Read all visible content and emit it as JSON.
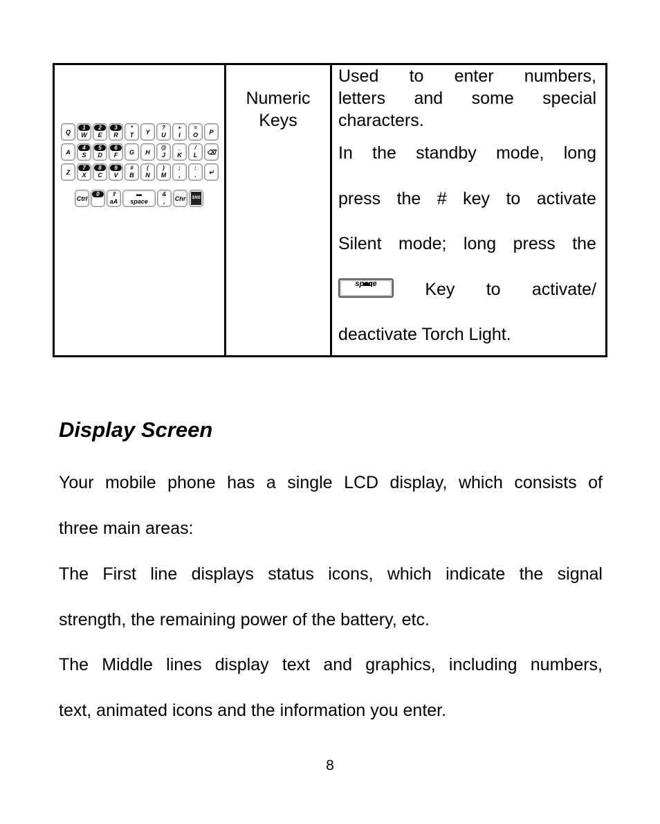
{
  "table": {
    "row": {
      "name_lines": [
        "Numeric",
        "Keys"
      ],
      "desc_para1_lines": [
        [
          "Used",
          "to",
          "enter",
          "numbers,"
        ],
        [
          "letters",
          "and",
          "some",
          "special"
        ],
        [
          "characters."
        ]
      ],
      "desc_para2_lines": [
        [
          "In",
          "the",
          "standby",
          "mode,",
          "long"
        ],
        [
          "press",
          "the",
          "#",
          "key",
          "to",
          "activate"
        ],
        [
          "Silent",
          "mode;",
          "long",
          "press",
          "the"
        ],
        [
          "Key",
          "to",
          "activate/"
        ],
        [
          "deactivate Torch Light."
        ]
      ],
      "inline_key_label": "space"
    },
    "keyboard": {
      "rows": [
        [
          {
            "b": "Q"
          },
          {
            "t": "1",
            "b": "W",
            "n": true
          },
          {
            "t": "2",
            "b": "E",
            "n": true
          },
          {
            "t": "3",
            "b": "R",
            "n": true
          },
          {
            "t": "*",
            "b": "T"
          },
          {
            "b": "Y"
          },
          {
            "t": "?",
            "b": "U"
          },
          {
            "t": "+",
            "b": "I"
          },
          {
            "t": "=",
            "b": "O"
          },
          {
            "b": "P"
          }
        ],
        [
          {
            "b": "A"
          },
          {
            "t": "4",
            "b": "S",
            "n": true
          },
          {
            "t": "5",
            "b": "D",
            "n": true
          },
          {
            "t": "6",
            "b": "F",
            "n": true
          },
          {
            "b": "G"
          },
          {
            "b": "H"
          },
          {
            "t": "@",
            "b": "J"
          },
          {
            "t": "_",
            "b": "K"
          },
          {
            "t": "/",
            "b": "L"
          },
          {
            "b": "⌫"
          }
        ],
        [
          {
            "b": "Z"
          },
          {
            "t": "7",
            "b": "X",
            "n": true
          },
          {
            "t": "8",
            "b": "C",
            "n": true
          },
          {
            "t": "9",
            "b": "V",
            "n": true
          },
          {
            "t": "#",
            "b": "B"
          },
          {
            "t": "(",
            "b": "N"
          },
          {
            "t": ")",
            "b": "M"
          },
          {
            "t": ";",
            "b": ","
          },
          {
            "t": ":",
            "b": "."
          },
          {
            "b": "↵"
          }
        ],
        [
          {
            "b": "Ctrl"
          },
          {
            "t": "0",
            "b": "",
            "n": true
          },
          {
            "t": "⇧",
            "b": "aA"
          },
          {
            "t": "▬",
            "b": "space",
            "space": true
          },
          {
            "t": "&",
            "b": ","
          },
          {
            "b": "Chr"
          },
          {
            "b": "SNS",
            "sns": true
          }
        ]
      ]
    }
  },
  "section": {
    "heading": "Display Screen",
    "paragraphs": [
      [
        [
          "Your",
          "mobile",
          "phone",
          "has",
          "a",
          "single",
          "LCD",
          "display,",
          "which",
          "consists",
          "of"
        ],
        [
          "three main areas:"
        ]
      ],
      [
        [
          "The",
          "First",
          "line",
          "displays",
          "status",
          "icons,",
          "which",
          "indicate",
          "the",
          "signal"
        ],
        [
          "strength, the remaining power of the battery, etc."
        ]
      ],
      [
        [
          "The",
          "Middle",
          "lines",
          "display",
          "text",
          "and",
          "graphics,",
          "including",
          "numbers,"
        ],
        [
          "text, animated icons and the information you enter."
        ]
      ]
    ]
  },
  "page_number": "8"
}
